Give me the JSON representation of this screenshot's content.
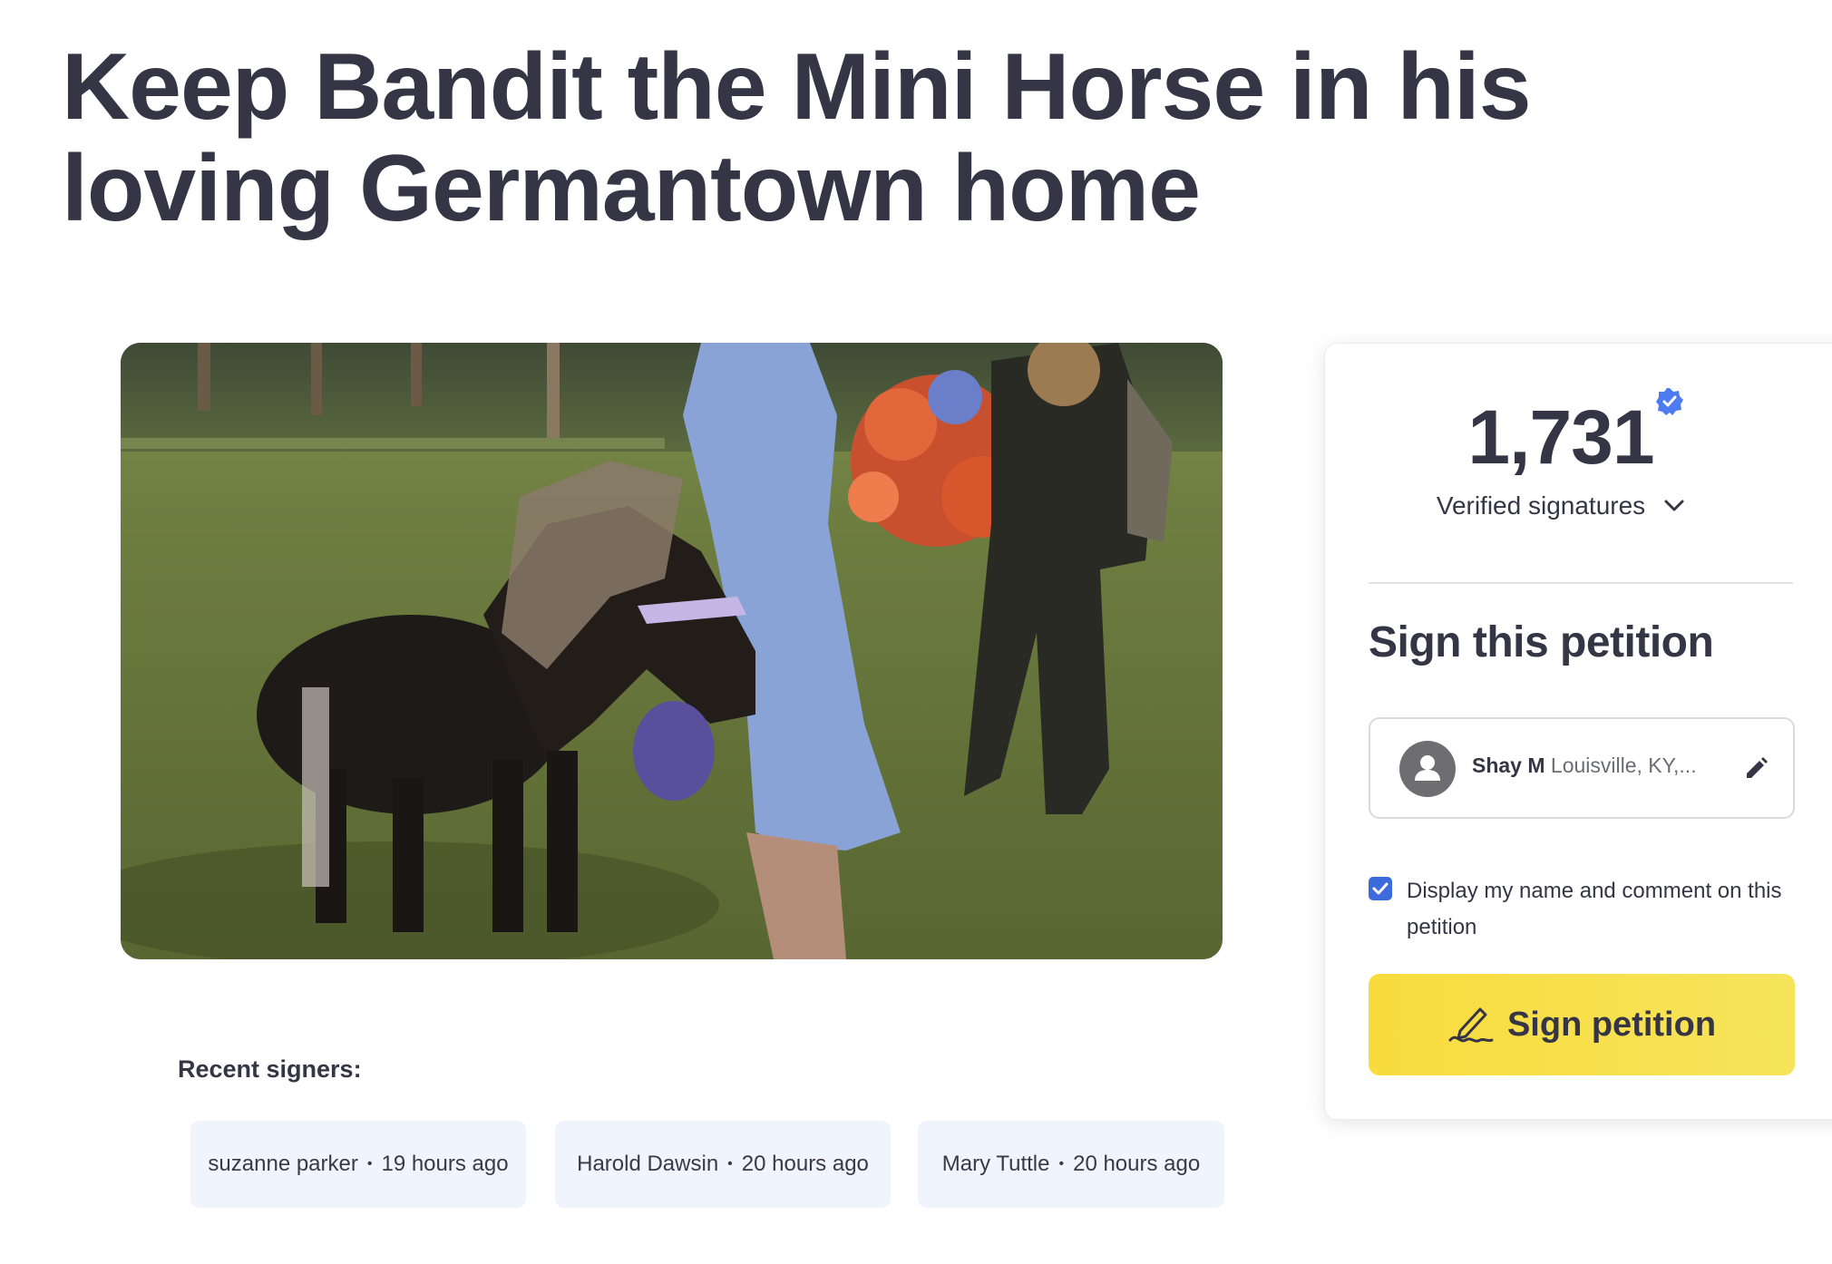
{
  "petition": {
    "title": "Keep Bandit the Mini Horse in his loving Germantown home"
  },
  "recent_signers": {
    "label": "Recent signers:",
    "items": [
      {
        "name": "suzanne parker",
        "time": "19 hours ago"
      },
      {
        "name": "Harold Dawsin",
        "time": "20 hours ago"
      },
      {
        "name": "Mary Tuttle",
        "time": "20 hours ago"
      }
    ]
  },
  "sidebar": {
    "count": "1,731",
    "verified_label": "Verified signatures",
    "sign_heading": "Sign this petition",
    "user": {
      "name": "Shay M",
      "location": "Louisville, KY,..."
    },
    "consent_text": "Display my name and comment on this petition",
    "consent_checked": true,
    "sign_button_label": "Sign petition"
  },
  "colors": {
    "accent_yellow": "#f8dc3d",
    "checkbox_blue": "#3e6bdc",
    "text_dark": "#363545",
    "pill_bg": "#eff4fd"
  },
  "icons": [
    "verified-badge-icon",
    "chevron-down-icon",
    "person-icon",
    "pencil-icon",
    "check-icon",
    "signature-pen-icon"
  ]
}
